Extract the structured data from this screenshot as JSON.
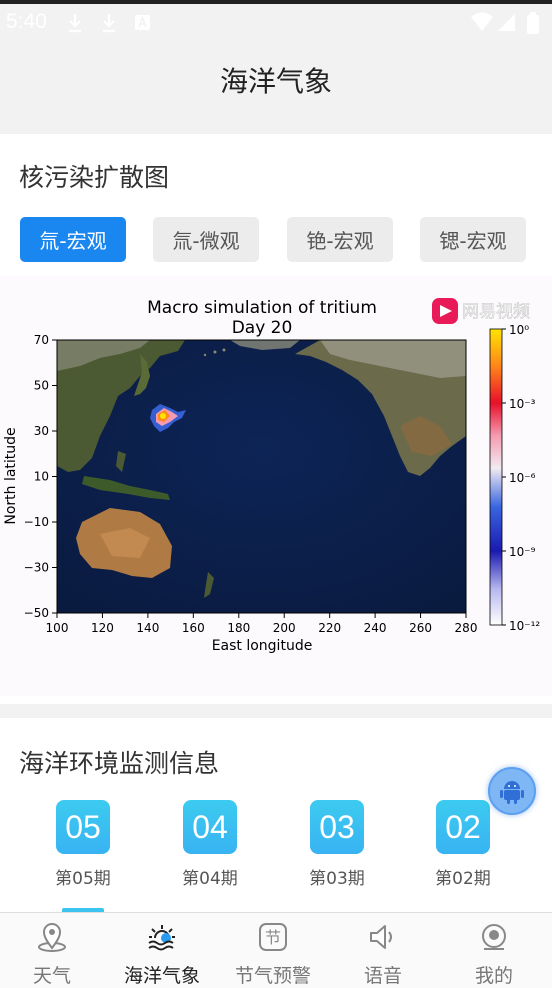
{
  "status_bar": {
    "time": "5:40"
  },
  "header": {
    "title": "海洋气象"
  },
  "section1": {
    "title": "核污染扩散图",
    "tabs": [
      {
        "label": "氚-宏观",
        "active": true
      },
      {
        "label": "氚-微观",
        "active": false
      },
      {
        "label": "铯-宏观",
        "active": false
      },
      {
        "label": "锶-宏观",
        "active": false
      }
    ]
  },
  "chart_data": {
    "type": "heatmap",
    "title": "Macro simulation of tritium",
    "subtitle": "Day 20",
    "xlabel": "East longitude",
    "ylabel": "North latitude",
    "xlim": [
      100,
      280
    ],
    "ylim": [
      -50,
      70
    ],
    "xticks": [
      "100",
      "120",
      "140",
      "160",
      "180",
      "200",
      "220",
      "240",
      "260",
      "280"
    ],
    "yticks": [
      "70",
      "50",
      "30",
      "10",
      "−10",
      "−30",
      "−50"
    ],
    "colorbar": {
      "scale": "log",
      "ticks": [
        "10⁰",
        "10⁻³",
        "10⁻⁶",
        "10⁻⁹",
        "10⁻¹²"
      ],
      "colors": [
        "#ffe400",
        "#ff7a1a",
        "#e8102a",
        "#f5a0b4",
        "#f2ecf4",
        "#3a66e0",
        "#1a1ab0",
        "#ffffff"
      ]
    },
    "plume": {
      "center_lon": 147,
      "center_lat": 36,
      "note": ""
    },
    "watermark": "网易视频"
  },
  "section2": {
    "title": "海洋环境监测信息",
    "issues": [
      {
        "number": "05",
        "label": "第05期"
      },
      {
        "number": "04",
        "label": "第04期"
      },
      {
        "number": "03",
        "label": "第03期"
      },
      {
        "number": "02",
        "label": "第02期"
      }
    ]
  },
  "bottom_nav": {
    "items": [
      {
        "label": "天气",
        "icon": "location-pin-icon",
        "active": false
      },
      {
        "label": "海洋气象",
        "icon": "sun-wave-icon",
        "active": true
      },
      {
        "label": "节气预警",
        "icon": "solar-term-icon",
        "active": false
      },
      {
        "label": "语音",
        "icon": "speaker-icon",
        "active": false
      },
      {
        "label": "我的",
        "icon": "profile-icon",
        "active": false
      }
    ]
  }
}
